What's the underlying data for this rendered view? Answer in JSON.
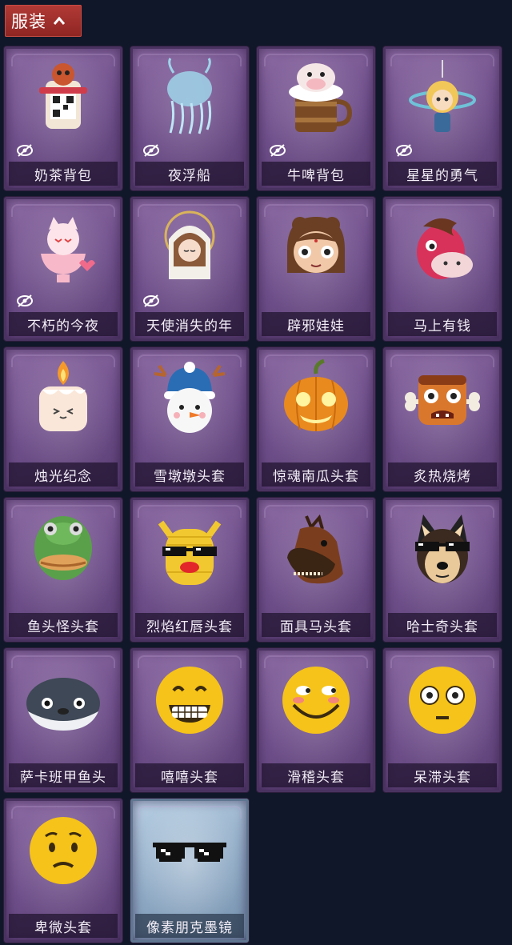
{
  "category": {
    "label": "服装",
    "toggle_icon": "chevron-up-icon"
  },
  "items": [
    {
      "name": "奶茶背包",
      "icon": "milk-tea-backpack-icon",
      "hidden": true,
      "tint": "purple"
    },
    {
      "name": "夜浮船",
      "icon": "jellyfish-icon",
      "hidden": true,
      "tint": "purple"
    },
    {
      "name": "牛啤背包",
      "icon": "cow-beer-mug-icon",
      "hidden": true,
      "tint": "purple"
    },
    {
      "name": "星星的勇气",
      "icon": "star-prince-icon",
      "hidden": true,
      "tint": "purple"
    },
    {
      "name": "不朽的今夜",
      "icon": "fox-cup-icon",
      "hidden": true,
      "tint": "purple"
    },
    {
      "name": "天使消失的年",
      "icon": "angel-girl-icon",
      "hidden": true,
      "tint": "purple"
    },
    {
      "name": "辟邪娃娃",
      "icon": "doll-head-icon",
      "hidden": false,
      "tint": "purple"
    },
    {
      "name": "马上有钱",
      "icon": "red-horse-head-icon",
      "hidden": false,
      "tint": "purple"
    },
    {
      "name": "烛光纪念",
      "icon": "candle-head-icon",
      "hidden": false,
      "tint": "purple"
    },
    {
      "name": "雪墩墩头套",
      "icon": "snowman-head-icon",
      "hidden": false,
      "tint": "purple"
    },
    {
      "name": "惊魂南瓜头套",
      "icon": "pumpkin-head-icon",
      "hidden": false,
      "tint": "purple"
    },
    {
      "name": "炙热烧烤",
      "icon": "bbq-meat-icon",
      "hidden": false,
      "tint": "purple"
    },
    {
      "name": "鱼头怪头套",
      "icon": "fish-head-icon",
      "hidden": false,
      "tint": "purple"
    },
    {
      "name": "烈焰红唇头套",
      "icon": "yellow-mask-icon",
      "hidden": false,
      "tint": "purple"
    },
    {
      "name": "面具马头套",
      "icon": "horse-mask-icon",
      "hidden": false,
      "tint": "purple"
    },
    {
      "name": "哈士奇头套",
      "icon": "husky-head-icon",
      "hidden": false,
      "tint": "purple"
    },
    {
      "name": "萨卡班甲鱼头",
      "icon": "sacabambaspis-icon",
      "hidden": false,
      "tint": "purple"
    },
    {
      "name": "嘻嘻头套",
      "icon": "grin-emoji-icon",
      "hidden": false,
      "tint": "purple"
    },
    {
      "name": "滑稽头套",
      "icon": "funny-emoji-icon",
      "hidden": false,
      "tint": "purple"
    },
    {
      "name": "呆滞头套",
      "icon": "dazed-emoji-icon",
      "hidden": false,
      "tint": "purple"
    },
    {
      "name": "卑微头套",
      "icon": "humble-emoji-icon",
      "hidden": false,
      "tint": "purple"
    },
    {
      "name": "像素朋克墨镜",
      "icon": "pixel-sunglasses-icon",
      "hidden": false,
      "tint": "blue"
    }
  ],
  "colors": {
    "background": "#0f1728",
    "header": "#a33330",
    "card_purple": "#7a5a93",
    "card_blue": "#9bb6cf"
  }
}
